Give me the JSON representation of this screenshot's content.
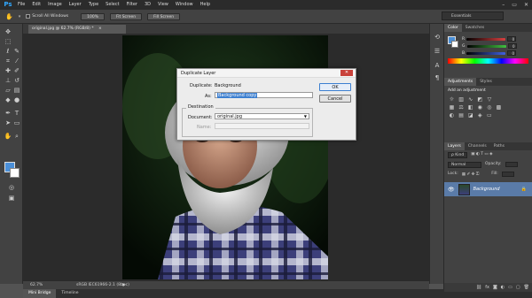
{
  "app": {
    "logo": "Ps"
  },
  "menubar": {
    "items": [
      "File",
      "Edit",
      "Image",
      "Layer",
      "Type",
      "Select",
      "Filter",
      "3D",
      "View",
      "Window",
      "Help"
    ],
    "window_controls": [
      "–",
      "▭",
      "✕"
    ]
  },
  "options_bar": {
    "scroll_all_windows": "Scroll All Windows",
    "btn_100": "100%",
    "fit_screen": "Fit Screen",
    "fill_screen": "Fill Screen",
    "workspace": "Essentials"
  },
  "document": {
    "tab_title": "original.jpg @ 62.7% (RGB/8) *",
    "tab_close": "×"
  },
  "status": {
    "zoom": "62.7%",
    "profile": "sRGB IEC61966-2.1 (8bpc)"
  },
  "bottom_tabs": [
    "Mini Bridge",
    "Timeline"
  ],
  "color_panel": {
    "tabs": [
      "Color",
      "Swatches"
    ],
    "channels": [
      {
        "label": "R",
        "value": "0",
        "track": "#d94040"
      },
      {
        "label": "G",
        "value": "0",
        "track": "#40c040"
      },
      {
        "label": "B",
        "value": "0",
        "track": "#4060e0"
      }
    ]
  },
  "adjustments_panel": {
    "tabs": [
      "Adjustments",
      "Styles"
    ],
    "heading": "Add an adjustment"
  },
  "layers_panel": {
    "tabs": [
      "Layers",
      "Channels",
      "Paths"
    ],
    "kind": "ρ Kind",
    "blend_mode": "Normal",
    "opacity_label": "Opacity:",
    "lock_label": "Lock:",
    "fill_label": "Fill:",
    "layer_name": "Background"
  },
  "dialog": {
    "title": "Duplicate Layer",
    "close": "✕",
    "duplicate_label": "Duplicate:",
    "duplicate_value": "Background",
    "as_label": "As:",
    "as_value": "Background copy",
    "destination_label": "Destination",
    "document_label": "Document:",
    "document_value": "original.jpg",
    "name_label": "Name:",
    "ok": "OK",
    "cancel": "Cancel"
  },
  "tools": [
    "move-icon",
    "marquee-icon",
    "lasso-icon",
    "quick-select-icon",
    "crop-icon",
    "eyedropper-icon",
    "healing-icon",
    "brush-icon",
    "stamp-icon",
    "history-brush-icon",
    "eraser-icon",
    "gradient-icon",
    "blur-icon",
    "dodge-icon",
    "pen-icon",
    "type-icon",
    "path-select-icon",
    "shape-icon",
    "hand-icon",
    "zoom-icon"
  ],
  "colors": {
    "foreground": "#4a8fd8",
    "background": "#ffffff",
    "accent": "#31a8ff"
  }
}
